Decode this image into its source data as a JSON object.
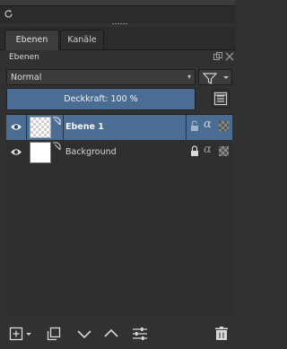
{
  "tabs": [
    {
      "label": "Ebenen",
      "active": true
    },
    {
      "label": "Kanäle",
      "active": false
    }
  ],
  "docker": {
    "title": "Ebenen"
  },
  "blending": {
    "selected": "Normal",
    "arrow": "▾"
  },
  "opacity": {
    "label": "Deckkraft:  100 %"
  },
  "layers": [
    {
      "name": "Ebene 1",
      "selected": true,
      "thumbnail": "transparent",
      "locked": false
    },
    {
      "name": "Background",
      "selected": false,
      "thumbnail": "white",
      "locked": true
    }
  ],
  "colors": {
    "accent": "#4b6d93",
    "background": "#313131",
    "list": "#2f2f2f"
  },
  "icons": [
    "eye-icon",
    "lock-icon",
    "alpha-icon",
    "filter-icon",
    "add-layer-icon",
    "duplicate-icon",
    "move-down-icon",
    "move-up-icon",
    "properties-icon",
    "delete-icon"
  ]
}
